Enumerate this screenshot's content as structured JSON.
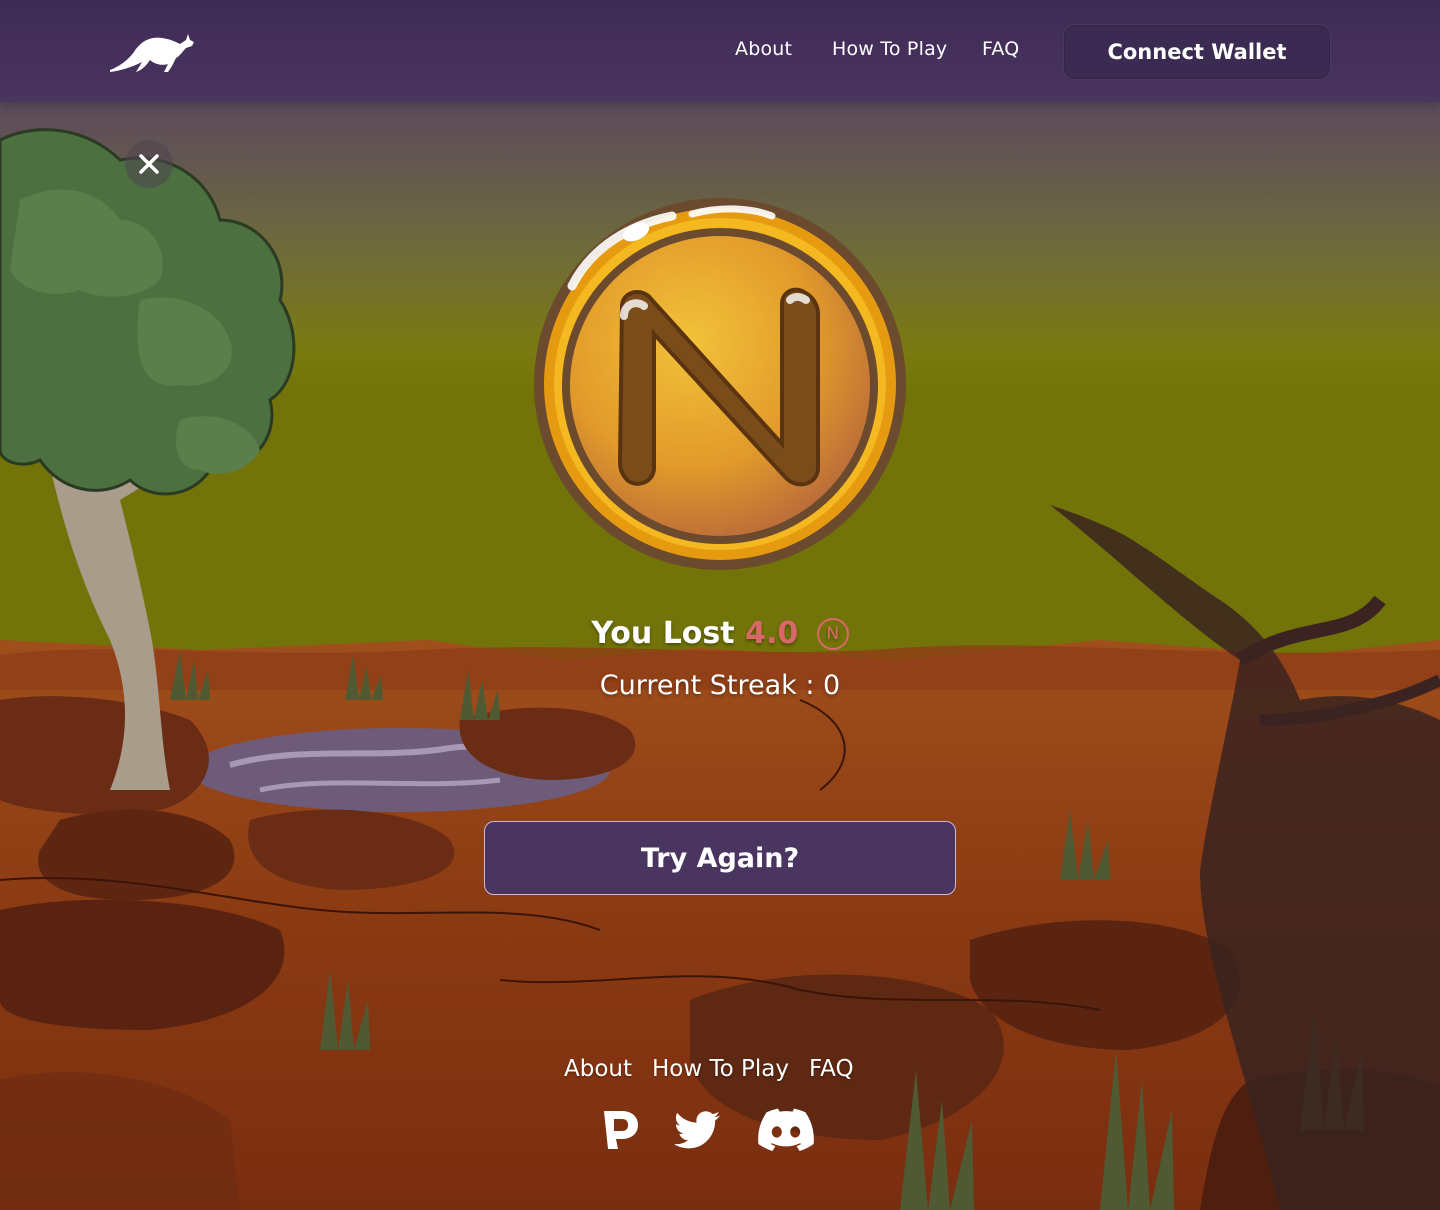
{
  "nav": {
    "logo_icon": "kangaroo-logo-icon",
    "links": [
      "About",
      "How To Play",
      "FAQ"
    ],
    "connect_label": "Connect Wallet"
  },
  "modal": {
    "close_icon": "close-icon",
    "coin_icon": "near-coin-icon",
    "result_prefix": "You Lost",
    "result_amount": "4.0",
    "currency_symbol": "N",
    "streak_text": "Current Streak : 0",
    "try_again_label": "Try Again?"
  },
  "footer": {
    "links": [
      "About",
      "How To Play",
      "FAQ"
    ],
    "socials": [
      "paras-icon",
      "twitter-icon",
      "discord-icon"
    ]
  },
  "colors": {
    "nav_bg": "#3e2b55",
    "accent_loss": "#d9686a",
    "button_bg": "#4a3560",
    "coin_gold": "#e8a317"
  }
}
